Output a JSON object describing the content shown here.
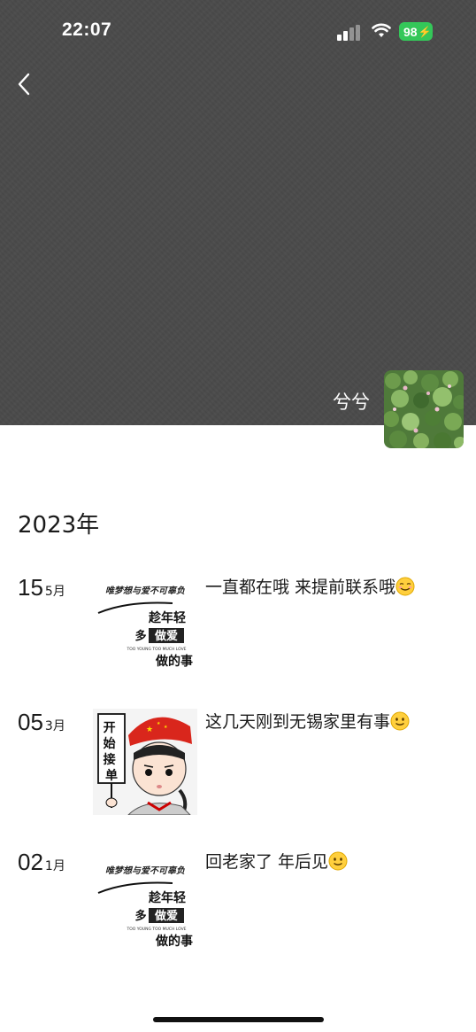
{
  "status_bar": {
    "time": "22:07",
    "battery": "98"
  },
  "profile": {
    "name": "兮兮"
  },
  "timeline": {
    "year": "2023年",
    "posts": [
      {
        "day": "15",
        "month": "5月",
        "text": "一直都在哦 来提前联系哦",
        "image_text": {
          "top": "唯梦想与爱不可辜负",
          "l1": "趁年轻",
          "l2": "多",
          "l2b": "做爱",
          "small": "TOO YOUNG TOO MUCH LOVE",
          "l3": "做的事"
        }
      },
      {
        "day": "05",
        "month": "3月",
        "text": "这几天刚到无锡家里有事",
        "image_text": {
          "sign": "开始接单"
        }
      },
      {
        "day": "02",
        "month": "1月",
        "text": "回老家了 年后见",
        "image_text": {
          "top": "唯梦想与爱不可辜负",
          "l1": "趁年轻",
          "l2": "多",
          "l2b": "做爱",
          "small": "TOO YOUNG TOO MUCH LOVE",
          "l3": "做的事"
        }
      }
    ]
  },
  "colors": {
    "cover": "#4a4a4a",
    "battery": "#34c759",
    "text": "#1a1a1a"
  }
}
